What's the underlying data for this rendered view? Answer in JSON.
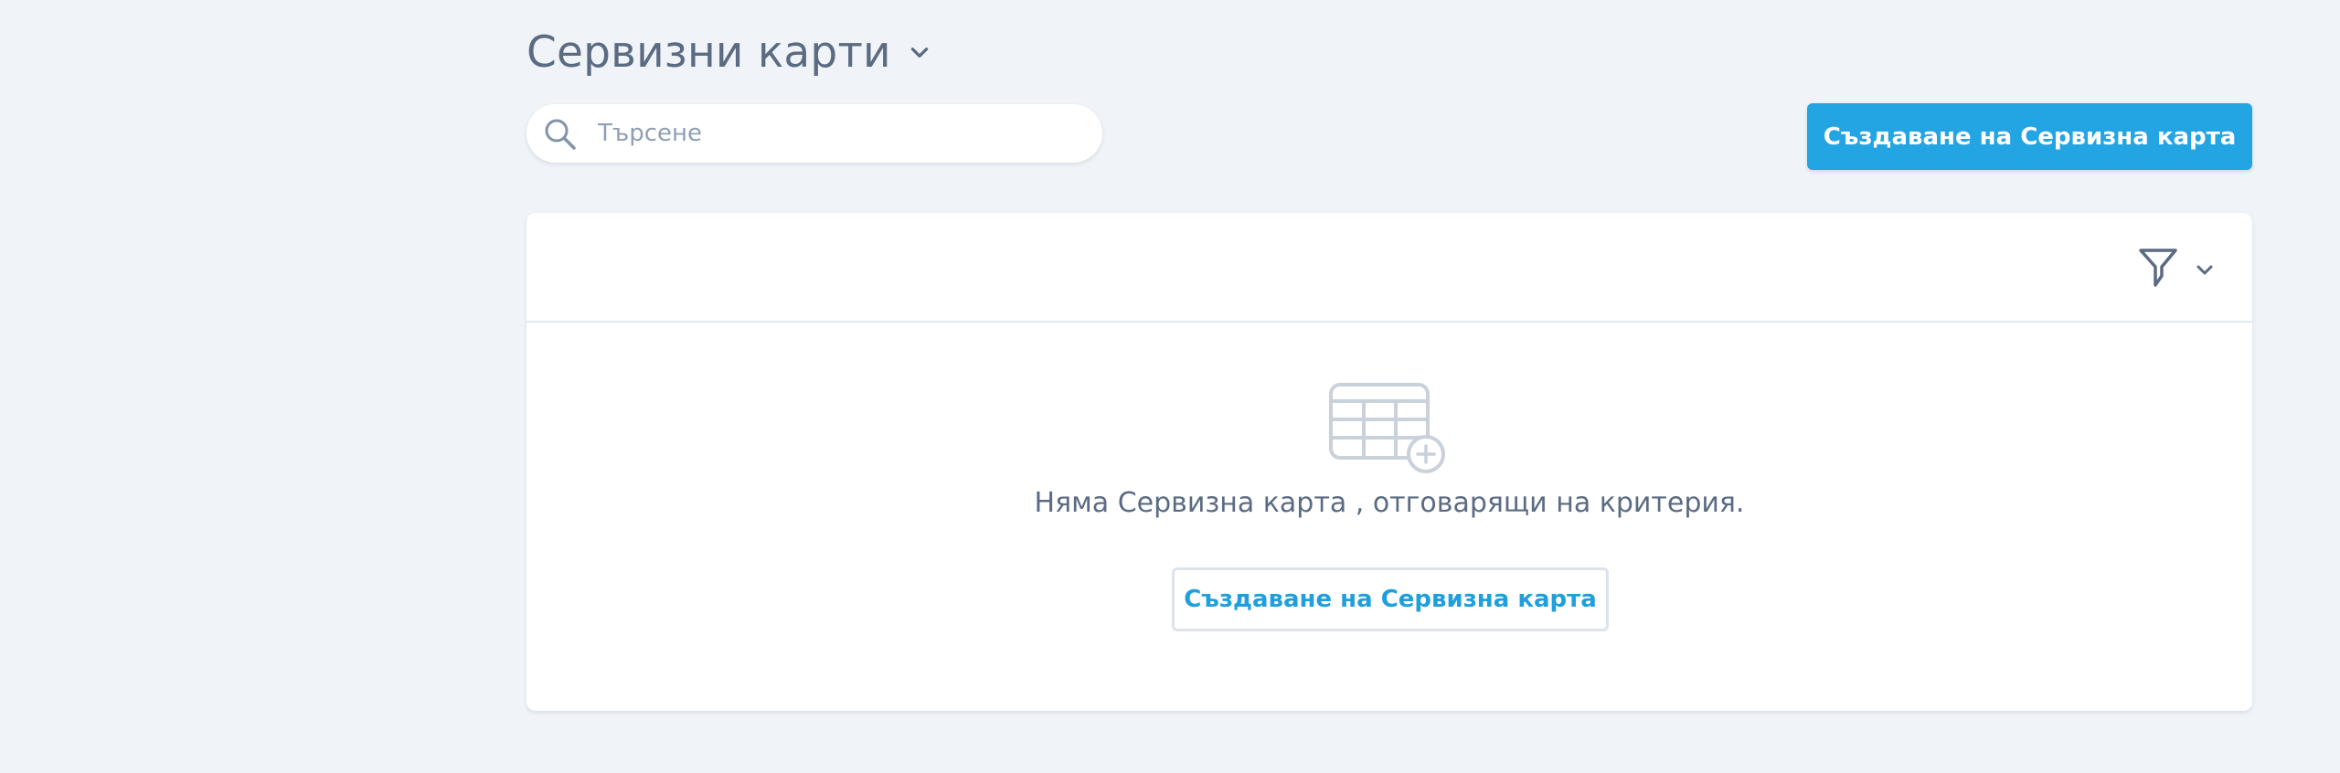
{
  "header": {
    "title": "Сервизни карти"
  },
  "search": {
    "placeholder": "Търсене",
    "value": ""
  },
  "toolbar": {
    "create_label": "Създаване на Сервизна карта"
  },
  "empty_state": {
    "message": "Няма Сервизна карта , отговарящи на критерия.",
    "create_label": "Създаване на Сервизна карта"
  },
  "colors": {
    "background": "#f0f4f8",
    "accent": "#23a5e4",
    "text_muted": "#5a6b82",
    "icon_muted": "#c9d1db",
    "divider": "#e3e8ee"
  },
  "icons": {
    "title_dropdown": "chevron-down-icon",
    "search": "search-icon",
    "filter": "filter-icon",
    "filter_dropdown": "chevron-down-icon",
    "empty": "table-add-icon"
  }
}
